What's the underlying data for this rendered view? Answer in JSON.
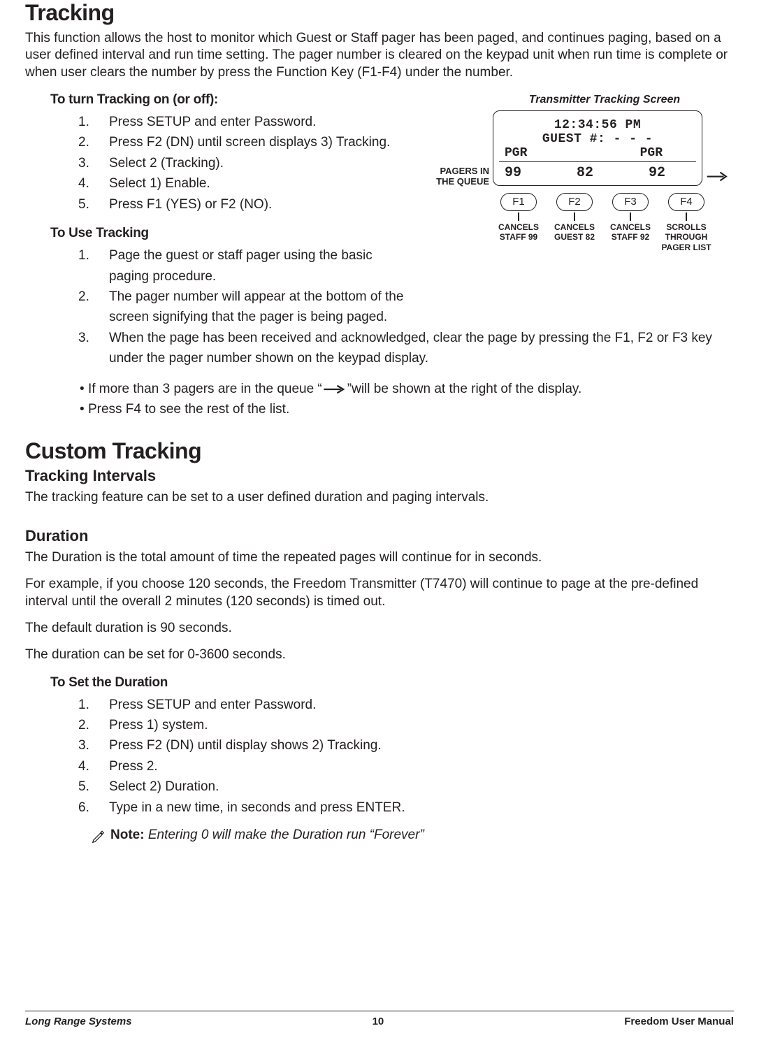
{
  "headings": {
    "tracking": "Tracking",
    "custom_tracking": "Custom Tracking",
    "tracking_intervals": "Tracking Intervals",
    "duration": "Duration"
  },
  "intro_para": "This function allows the host to monitor which Guest or Staff pager has been paged, and continues paging, based on a user defined interval and run time setting. The pager number is cleared on the keypad unit when run time is complete or when user clears the number by press the Function Key (F1-F4) under the number.",
  "turn_on": {
    "heading": "To turn Tracking on (or off):",
    "steps": [
      "Press SETUP and enter Password.",
      "Press F2 (DN) until screen displays 3) Tracking.",
      "Select 2 (Tracking).",
      "Select 1) Enable.",
      "Press F1 (YES) or F2 (NO)."
    ]
  },
  "use_tracking": {
    "heading": "To Use Tracking",
    "steps": [
      "Page the guest or staff pager using the basic paging procedure.",
      "The pager number will appear at the bottom of the screen signifying that the pager is being paged.",
      "When the page has been received and acknowledged, clear the page by pressing the F1, F2 or F3 key under the pager number shown on the keypad display."
    ],
    "bullets": {
      "b1_pre": "If more than 3 pagers are in the queue  “",
      "b1_post": "”will be shown at the right of the display.",
      "b2": "Press F4 to see the rest of the list."
    }
  },
  "diagram": {
    "caption": "Transmitter Tracking Screen",
    "time": "12:34:56 PM",
    "guest": "GUEST #: - - -",
    "pgr_left": "PGR",
    "pgr_right": "PGR",
    "queue": [
      "99",
      "82",
      "92"
    ],
    "pagers_label": "PAGERS IN THE QUEUE",
    "fkeys": [
      {
        "label": "F1",
        "desc": "CANCELS STAFF 99"
      },
      {
        "label": "F2",
        "desc": "CANCELS GUEST 82"
      },
      {
        "label": "F3",
        "desc": "CANCELS STAFF 92"
      },
      {
        "label": "F4",
        "desc": "SCROLLS THROUGH PAGER LIST"
      }
    ]
  },
  "intervals_para": "The tracking feature can be set to a user defined duration and paging intervals.",
  "duration_paras": [
    "The Duration is the total amount of time the repeated pages will continue for in seconds.",
    "For example, if you choose 120 seconds, the Freedom Transmitter (T7470) will continue to page at the pre-defined interval until the overall 2 minutes (120 seconds) is timed out.",
    "The default duration is 90 seconds.",
    "The duration can be set for 0-3600 seconds."
  ],
  "set_duration": {
    "heading": "To Set the Duration",
    "steps": [
      "Press SETUP and enter Password.",
      "Press 1) system.",
      "Press F2 (DN) until display shows 2) Tracking.",
      "Press 2.",
      "Select 2) Duration.",
      "Type in a new time, in seconds and press ENTER."
    ],
    "note_label": "Note:",
    "note_text": "Entering 0 will make the Duration run “Forever”"
  },
  "footer": {
    "left": "Long Range Systems",
    "center": "10",
    "right": "Freedom User Manual"
  }
}
